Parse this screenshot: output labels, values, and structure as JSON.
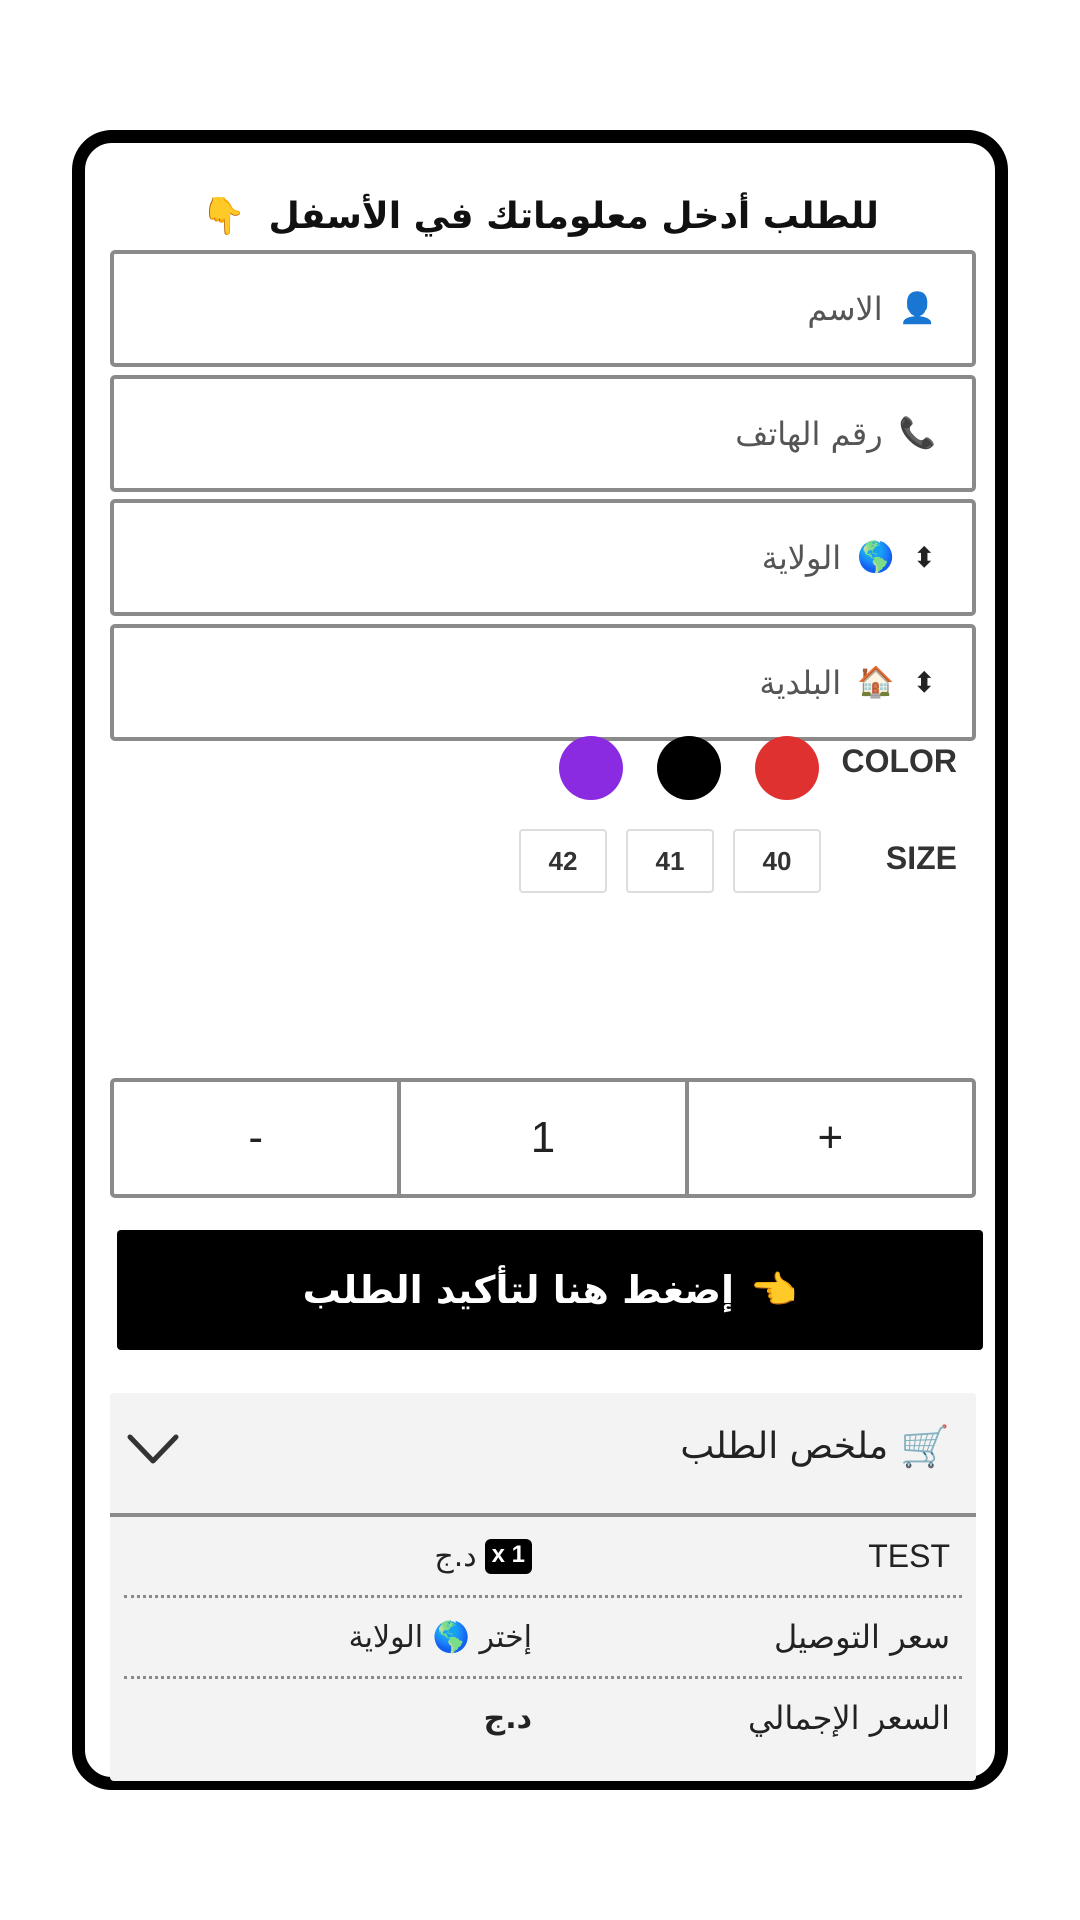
{
  "form": {
    "title": "للطلب أدخل معلوماتك في الأسفل",
    "title_icon": "👇",
    "fields": [
      {
        "placeholder": "الاسم",
        "icon": "👤"
      },
      {
        "placeholder": "رقم الهاتف",
        "icon": "📞"
      },
      {
        "selected": "الولاية",
        "icon": "🌎",
        "caret": "⬍"
      },
      {
        "selected": "البلدية",
        "icon": "🏠",
        "caret": "⬍"
      }
    ]
  },
  "options": {
    "color_label": "COLOR",
    "colors": [
      "#e03131",
      "#000000",
      "#8a2be2"
    ],
    "size_label": "SIZE",
    "sizes": [
      "40",
      "41",
      "42"
    ]
  },
  "quantity": {
    "minus": "-",
    "value": "1",
    "plus": "+"
  },
  "confirm": {
    "label": "إضغط هنا لتأكيد الطلب",
    "icon": "👈"
  },
  "summary": {
    "title": "ملخص الطلب",
    "cart_icon": "🛒",
    "rows": [
      {
        "label": "TEST",
        "badge": "x 1",
        "value": "د.ج"
      },
      {
        "label": "سعر التوصيل",
        "value": "إختر 🌎 الولاية"
      },
      {
        "label": "السعر الإجمالي",
        "value": "د.ج"
      }
    ]
  },
  "colors": {
    "border": "#000000",
    "input_border": "#8a8a8a",
    "button_bg": "#000000",
    "summary_bg": "#f3f3f3"
  }
}
